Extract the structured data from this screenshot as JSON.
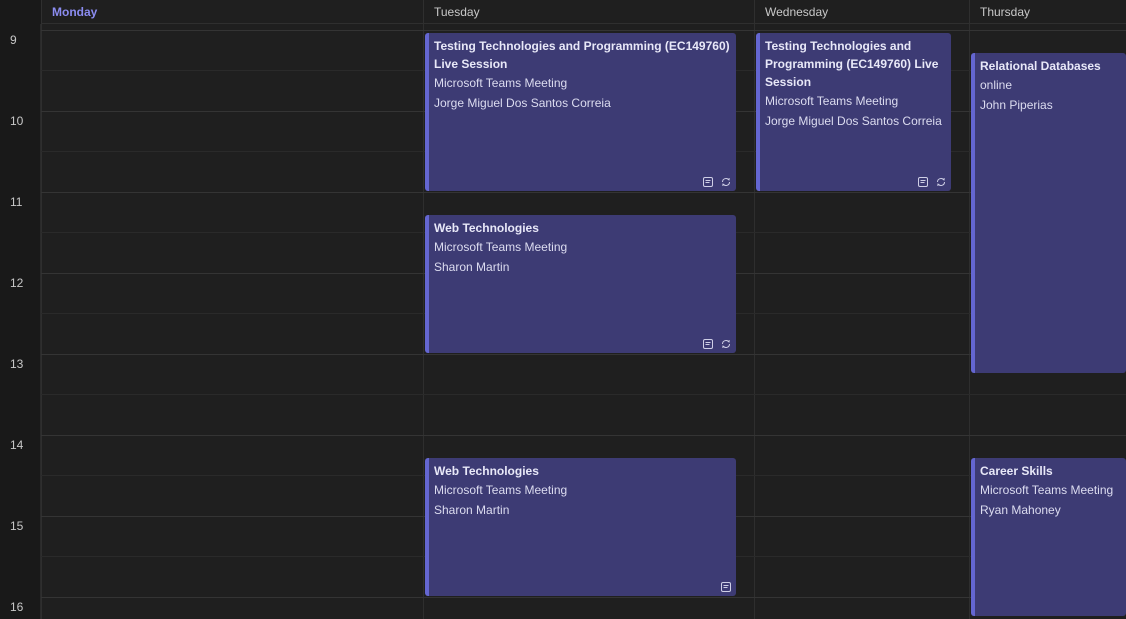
{
  "days": [
    "Monday",
    "Tuesday",
    "Wednesday",
    "Thursday"
  ],
  "hours": [
    "9",
    "10",
    "11",
    "12",
    "13",
    "14",
    "15",
    "16"
  ],
  "events": [
    {
      "title": "Testing Technologies and Programming (EC149760) Live Session",
      "location": "Microsoft Teams Meeting",
      "organizer": "Jorge Miguel Dos Santos Correia",
      "day": "Tuesday",
      "icons": [
        "notes-icon",
        "recurring-icon"
      ]
    },
    {
      "title": "Testing Technologies and Programming (EC149760) Live Session",
      "location": "Microsoft Teams Meeting",
      "organizer": "Jorge Miguel Dos Santos Correia",
      "day": "Wednesday",
      "icons": [
        "notes-icon",
        "recurring-icon"
      ]
    },
    {
      "title": "Relational Databases",
      "location": "online",
      "organizer": "John Piperias",
      "day": "Thursday",
      "icons": []
    },
    {
      "title": "Web Technologies",
      "location": "Microsoft Teams Meeting",
      "organizer": "Sharon Martin",
      "day": "Tuesday",
      "icons": [
        "notes-icon",
        "recurring-icon"
      ]
    },
    {
      "title": "Web Technologies",
      "location": "Microsoft Teams Meeting",
      "organizer": "Sharon Martin",
      "day": "Tuesday",
      "icons": [
        "notes-icon"
      ]
    },
    {
      "title": "Career Skills",
      "location": "Microsoft Teams Meeting",
      "organizer": "Ryan Mahoney",
      "day": "Thursday",
      "icons": []
    }
  ],
  "colors": {
    "event_bg": "#3d3b74",
    "event_accent": "#6466d1",
    "today": "#8b8cf0"
  }
}
